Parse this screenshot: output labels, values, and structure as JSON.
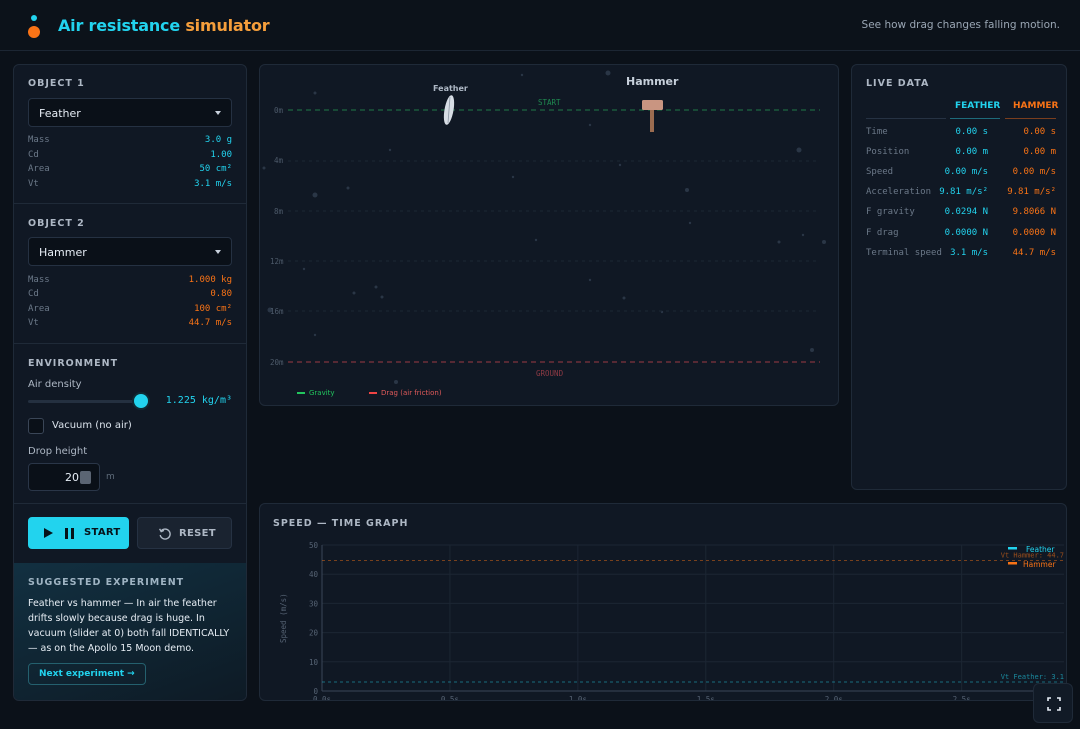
{
  "header": {
    "title_main": "Air resistance ",
    "title_accent": "simulator",
    "tagline": "See how drag changes falling motion."
  },
  "object1": {
    "section": "OBJECT 1",
    "selected": "Feather",
    "props": [
      {
        "k": "Mass",
        "v": "3.0 g"
      },
      {
        "k": "Cd",
        "v": "1.00"
      },
      {
        "k": "Area",
        "v": "50 cm²"
      },
      {
        "k": "Vt",
        "v": "3.1 m/s"
      }
    ]
  },
  "object2": {
    "section": "OBJECT 2",
    "selected": "Hammer",
    "props": [
      {
        "k": "Mass",
        "v": "1.000 kg"
      },
      {
        "k": "Cd",
        "v": "0.80"
      },
      {
        "k": "Area",
        "v": "100 cm²"
      },
      {
        "k": "Vt",
        "v": "44.7 m/s"
      }
    ]
  },
  "environment": {
    "section": "ENVIRONMENT",
    "air_density_label": "Air density",
    "air_density_value": "1.225 kg/m³",
    "air_density_fraction": 0.95,
    "vacuum_label": "Vacuum (no air)",
    "vacuum_checked": false,
    "drop_height_label": "Drop height",
    "drop_height_value": "20",
    "drop_height_unit": "m"
  },
  "controls": {
    "start_label": "START",
    "reset_label": "RESET"
  },
  "suggestion": {
    "section": "SUGGESTED EXPERIMENT",
    "text": "Feather vs hammer — In air the feather drifts slowly because drag is huge. In vacuum (slider at 0) both fall IDENTICALLY — as on the Apollo 15 Moon demo.",
    "next_label": "Next experiment →"
  },
  "simulation": {
    "label_feather": "Feather",
    "label_hammer": "Hammer",
    "start_label": "START",
    "ground_label": "GROUND",
    "ruler": [
      "0m",
      "4m",
      "8m",
      "12m",
      "16m",
      "20m"
    ],
    "legend_gravity": "Gravity",
    "legend_drag": "Drag (air friction)"
  },
  "live_data": {
    "section": "LIVE DATA",
    "col_a": "FEATHER",
    "col_b": "HAMMER",
    "rows": [
      {
        "k": "Time",
        "a": "0.00 s",
        "b": "0.00 s"
      },
      {
        "k": "Position",
        "a": "0.00 m",
        "b": "0.00 m"
      },
      {
        "k": "Speed",
        "a": "0.00 m/s",
        "b": "0.00 m/s"
      },
      {
        "k": "Acceleration",
        "a": "9.81 m/s²",
        "b": "9.81 m/s²"
      },
      {
        "k": "F gravity",
        "a": "0.0294 N",
        "b": "9.8066 N"
      },
      {
        "k": "F drag",
        "a": "0.0000 N",
        "b": "0.0000 N"
      },
      {
        "k": "Terminal speed",
        "a": "3.1 m/s",
        "b": "44.7 m/s"
      }
    ]
  },
  "colors": {
    "accent": "#22d3ee",
    "secondary": "#f97316",
    "gravity": "#22c55e",
    "drag": "#ef4444"
  },
  "chart_data": {
    "type": "line",
    "title": "SPEED — TIME GRAPH",
    "xlabel": "",
    "ylabel": "Speed (m/s)",
    "xlim": [
      0,
      2.9
    ],
    "ylim": [
      0,
      50
    ],
    "x_ticks": [
      "0.0s",
      "0.5s",
      "1.0s",
      "1.5s",
      "2.0s",
      "2.5s"
    ],
    "x_tick_values": [
      0,
      0.5,
      1.0,
      1.5,
      2.0,
      2.5
    ],
    "y_ticks": [
      0,
      10,
      20,
      30,
      40,
      50
    ],
    "grid": true,
    "legend_position": "top-right",
    "series": [
      {
        "name": "Feather",
        "color": "#22d3ee",
        "x": [],
        "y": []
      },
      {
        "name": "Hammer",
        "color": "#f97316",
        "x": [],
        "y": []
      }
    ],
    "reference_lines": [
      {
        "label": "Vt Feather: 3.1",
        "value": 3.1,
        "color": "#22d3ee"
      },
      {
        "label": "Vt Hammer: 44.7",
        "value": 44.7,
        "color": "#f97316"
      }
    ]
  }
}
